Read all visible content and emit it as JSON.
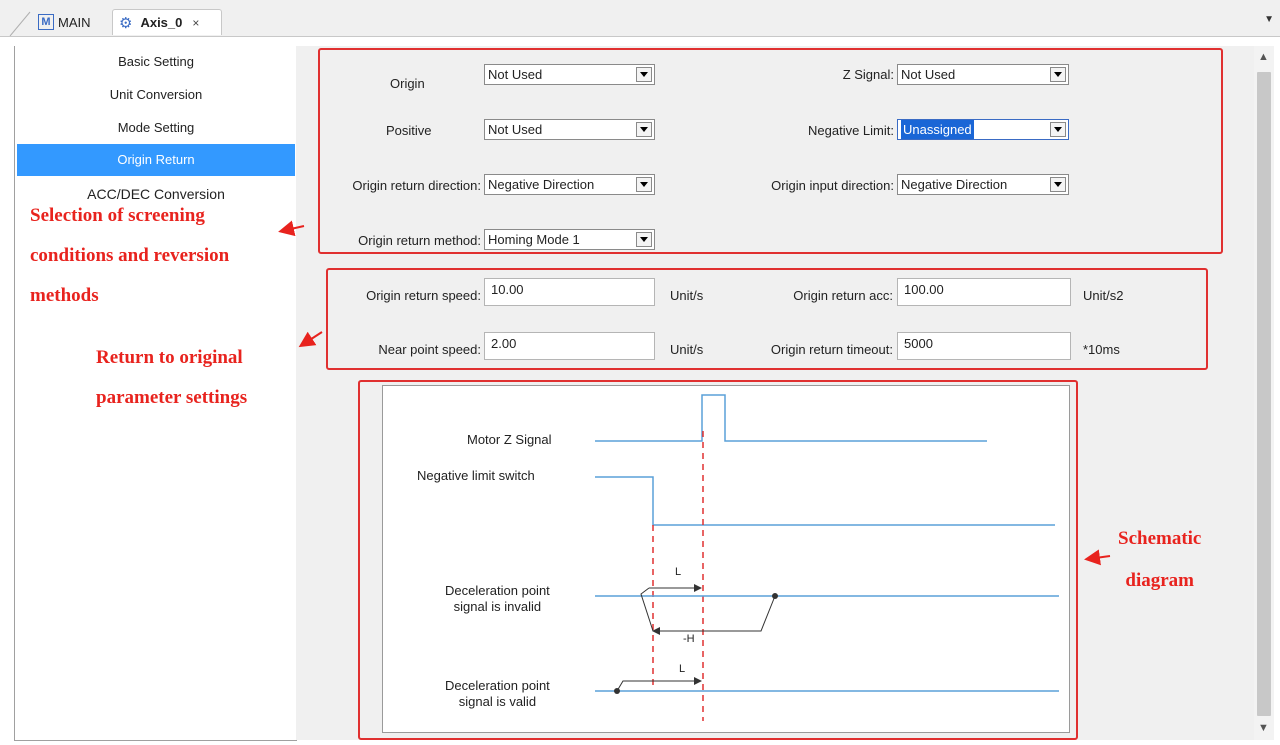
{
  "tabs": [
    {
      "label": "MAIN",
      "icon": "m-logo-icon"
    },
    {
      "label": "Axis_0",
      "icon": "gear-icon",
      "close": "×"
    }
  ],
  "sidebar": {
    "items": [
      {
        "label": "Basic Setting"
      },
      {
        "label": "Unit Conversion"
      },
      {
        "label": "Mode Setting"
      },
      {
        "label": "Origin Return",
        "active": true
      },
      {
        "label": "ACC/DEC Conversion"
      }
    ]
  },
  "conditions": {
    "origin": {
      "label": "Origin",
      "value": "Not Used"
    },
    "z_signal": {
      "label": "Z Signal:",
      "value": "Not Used"
    },
    "positive": {
      "label": "Positive",
      "value": "Not Used"
    },
    "negative_limit": {
      "label": "Negative Limit:",
      "value": "Unassigned"
    },
    "return_direction": {
      "label": "Origin return direction:",
      "value": "Negative Direction"
    },
    "input_direction": {
      "label": "Origin input direction:",
      "value": "Negative Direction"
    },
    "return_method": {
      "label": "Origin return method:",
      "value": "Homing Mode 1"
    }
  },
  "params": {
    "return_speed": {
      "label": "Origin return speed:",
      "value": "10.00",
      "unit": "Unit/s"
    },
    "return_acc": {
      "label": "Origin return acc:",
      "value": "100.00",
      "unit": "Unit/s2"
    },
    "near_speed": {
      "label": "Near point speed:",
      "value": "2.00",
      "unit": "Unit/s"
    },
    "return_timeout": {
      "label": "Origin return timeout:",
      "value": "5000",
      "unit": "*10ms"
    }
  },
  "annotations": {
    "selection": [
      "Selection of screening",
      "conditions and reversion",
      "methods"
    ],
    "return": [
      "Return to original",
      "parameter settings"
    ],
    "schematic": [
      "Schematic",
      "diagram"
    ]
  },
  "diagram": {
    "motor_z": "Motor Z Signal",
    "neg_limit": "Negative limit switch",
    "decel_invalid": [
      "Deceleration point",
      "signal is invalid"
    ],
    "decel_valid": [
      "Deceleration point",
      "signal is valid"
    ],
    "l_label": "L",
    "h_label": "-H"
  },
  "colors": {
    "accent": "#3399ff",
    "annotation": "#e8231e",
    "signal_line": "#5aa0d8",
    "dashed": "#e03030"
  }
}
